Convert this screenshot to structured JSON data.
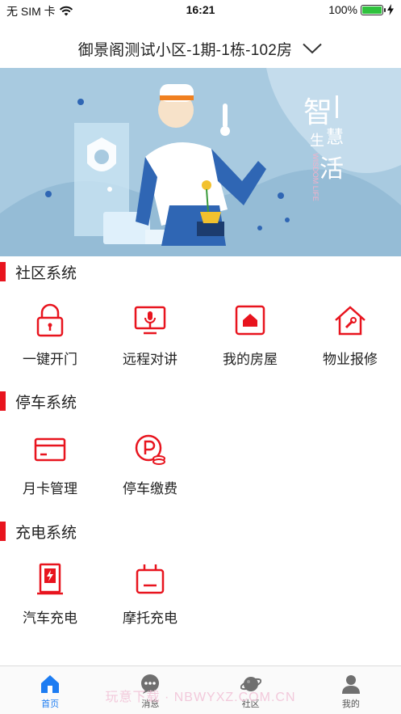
{
  "status_bar": {
    "carrier": "无 SIM 卡",
    "time": "16:21",
    "battery": "100%",
    "battery_level": 1.0
  },
  "header": {
    "title": "御景阁测试小区-1期-1栋-102房"
  },
  "banner": {
    "text_zhi": "智",
    "text_sheng": "生",
    "text_hui": "慧",
    "text_huo": "活",
    "text_en": "WISDOM LIFE"
  },
  "sections": [
    {
      "title": "社区系统",
      "items": [
        {
          "label": "一键开门",
          "icon": "lock-icon"
        },
        {
          "label": "远程对讲",
          "icon": "intercom-monitor-icon"
        },
        {
          "label": "我的房屋",
          "icon": "house-icon"
        },
        {
          "label": "物业报修",
          "icon": "repair-house-icon"
        }
      ]
    },
    {
      "title": "停车系统",
      "items": [
        {
          "label": "月卡管理",
          "icon": "card-icon"
        },
        {
          "label": "停车缴费",
          "icon": "parking-coin-icon"
        }
      ]
    },
    {
      "title": "充电系统",
      "items": [
        {
          "label": "汽车充电",
          "icon": "charging-pile-icon"
        },
        {
          "label": "摩托充电",
          "icon": "charger-socket-icon"
        }
      ]
    }
  ],
  "tabbar": {
    "tabs": [
      {
        "label": "首页",
        "icon": "home-icon",
        "active": true
      },
      {
        "label": "消息",
        "icon": "message-icon",
        "active": false
      },
      {
        "label": "社区",
        "icon": "community-icon",
        "active": false
      },
      {
        "label": "我的",
        "icon": "user-icon",
        "active": false
      }
    ]
  },
  "watermark": "玩意下载 · NBWYXZ.COM.CN",
  "colors": {
    "accent_red": "#e8141e",
    "active_blue": "#1c7cf2"
  }
}
